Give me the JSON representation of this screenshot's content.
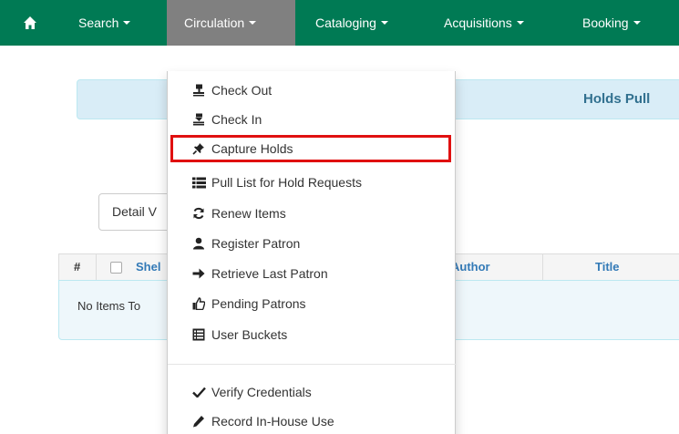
{
  "navbar": {
    "background": "#007a54",
    "active_background": "#808080",
    "items": [
      {
        "label": "Search"
      },
      {
        "label": "Circulation"
      },
      {
        "label": "Cataloging"
      },
      {
        "label": "Acquisitions"
      },
      {
        "label": "Booking"
      }
    ]
  },
  "banner": {
    "title": "Holds Pull"
  },
  "toolbar": {
    "detail_view_label": "Detail V"
  },
  "grid": {
    "columns": {
      "number": "#",
      "shelf": "Shel",
      "author": "Author",
      "title": "Title"
    },
    "empty_message": "No Items To"
  },
  "circulation_menu": {
    "highlight_color": "#e01010",
    "items": [
      {
        "label": "Check Out",
        "icon": "check-out-icon"
      },
      {
        "label": "Check In",
        "icon": "check-in-icon"
      },
      {
        "label": "Capture Holds",
        "icon": "pushpin-icon",
        "highlighted": true
      },
      {
        "label": "Pull List for Hold Requests",
        "icon": "list-icon"
      },
      {
        "label": "Renew Items",
        "icon": "refresh-icon"
      },
      {
        "label": "Register Patron",
        "icon": "user-icon"
      },
      {
        "label": "Retrieve Last Patron",
        "icon": "arrow-right-icon"
      },
      {
        "label": "Pending Patrons",
        "icon": "thumbs-up-icon"
      },
      {
        "label": "User Buckets",
        "icon": "bucket-list-icon"
      },
      {
        "label": "Verify Credentials",
        "icon": "checkmark-icon"
      },
      {
        "label": "Record In-House Use",
        "icon": "pencil-icon"
      }
    ]
  }
}
